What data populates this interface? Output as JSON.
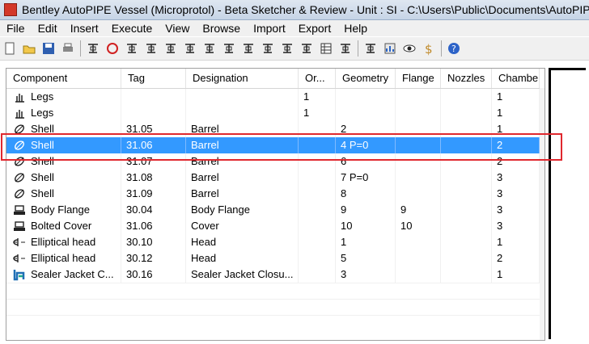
{
  "window": {
    "title": "Bentley AutoPIPE Vessel (Microprotol) - Beta Sketcher & Review  - Unit : SI - C:\\Users\\Public\\Documents\\AutoPIPE"
  },
  "menu": [
    "File",
    "Edit",
    "Insert",
    "Execute",
    "View",
    "Browse",
    "Import",
    "Export",
    "Help"
  ],
  "toolbar": {
    "icons": [
      "new-icon",
      "open-icon",
      "save-icon",
      "print-icon",
      "vessel-icon",
      "rotate-icon",
      "box-icon",
      "nozzle-icon",
      "support-icon",
      "flange-icon",
      "valve-icon",
      "ladder-icon",
      "bracket-icon",
      "saddle-icon",
      "lug-icon",
      "clip-icon",
      "table-icon",
      "tray-icon",
      "list-icon",
      "chart-icon",
      "eye-icon",
      "dollar-icon",
      "help-icon"
    ]
  },
  "grid": {
    "columns": [
      "Component",
      "Tag",
      "Designation",
      "Or...",
      "Geometry",
      "Flange",
      "Nozzles",
      "Chambe"
    ],
    "rows": [
      {
        "icon": "legs-icon",
        "component": "Legs",
        "tag": "",
        "designation": "",
        "orientation": "1",
        "geometry": "",
        "flange": "",
        "nozzles": "",
        "chamber": "1",
        "selected": false
      },
      {
        "icon": "legs-icon",
        "component": "Legs",
        "tag": "",
        "designation": "",
        "orientation": "1",
        "geometry": "",
        "flange": "",
        "nozzles": "",
        "chamber": "1",
        "selected": false
      },
      {
        "icon": "shell-icon",
        "component": "Shell",
        "tag": "31.05",
        "designation": "Barrel",
        "orientation": "",
        "geometry": "2",
        "flange": "",
        "nozzles": "",
        "chamber": "1",
        "selected": false
      },
      {
        "icon": "shell-icon",
        "component": "Shell",
        "tag": "31.06",
        "designation": "Barrel",
        "orientation": "",
        "geometry": "4 P=0",
        "flange": "",
        "nozzles": "",
        "chamber": "2",
        "selected": true
      },
      {
        "icon": "shell-icon",
        "component": "Shell",
        "tag": "31.07",
        "designation": "Barrel",
        "orientation": "",
        "geometry": "6",
        "flange": "",
        "nozzles": "",
        "chamber": "2",
        "selected": false
      },
      {
        "icon": "shell-icon",
        "component": "Shell",
        "tag": "31.08",
        "designation": "Barrel",
        "orientation": "",
        "geometry": "7 P=0",
        "flange": "",
        "nozzles": "",
        "chamber": "3",
        "selected": false
      },
      {
        "icon": "shell-icon",
        "component": "Shell",
        "tag": "31.09",
        "designation": "Barrel",
        "orientation": "",
        "geometry": "8",
        "flange": "",
        "nozzles": "",
        "chamber": "3",
        "selected": false
      },
      {
        "icon": "body-flange-icon",
        "component": "Body Flange",
        "tag": "30.04",
        "designation": "Body Flange",
        "orientation": "",
        "geometry": "9",
        "flange": "9",
        "nozzles": "",
        "chamber": "3",
        "selected": false
      },
      {
        "icon": "bolted-cover-icon",
        "component": "Bolted Cover",
        "tag": "31.06",
        "designation": "Cover",
        "orientation": "",
        "geometry": "10",
        "flange": "10",
        "nozzles": "",
        "chamber": "3",
        "selected": false
      },
      {
        "icon": "elliptical-head-icon",
        "component": "Elliptical head",
        "tag": "30.10",
        "designation": "Head",
        "orientation": "",
        "geometry": "1",
        "flange": "",
        "nozzles": "",
        "chamber": "1",
        "selected": false
      },
      {
        "icon": "elliptical-head-icon",
        "component": "Elliptical head",
        "tag": "30.12",
        "designation": "Head",
        "orientation": "",
        "geometry": "5",
        "flange": "",
        "nozzles": "",
        "chamber": "2",
        "selected": false
      },
      {
        "icon": "sealer-jacket-icon",
        "component": "Sealer Jacket C...",
        "tag": "30.16",
        "designation": "Sealer Jacket Closu...",
        "orientation": "",
        "geometry": "3",
        "flange": "",
        "nozzles": "",
        "chamber": "1",
        "selected": false
      }
    ]
  },
  "colors": {
    "selection": "#3399ff",
    "highlight_box": "#e0282e"
  }
}
